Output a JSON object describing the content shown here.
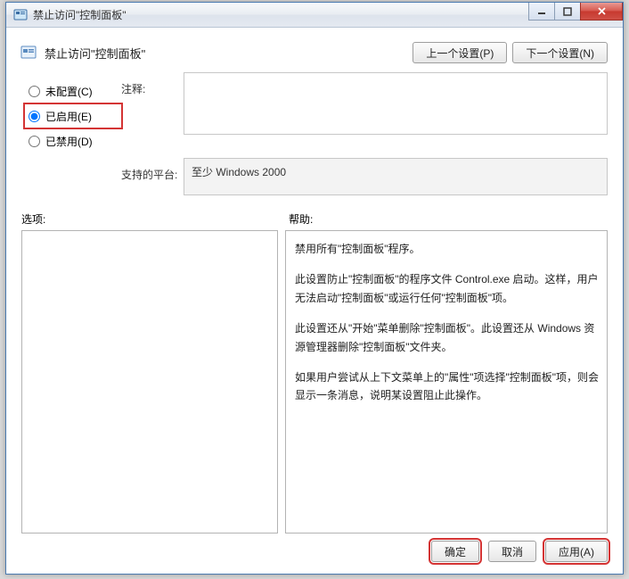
{
  "window": {
    "title": "禁止访问\"控制面板\""
  },
  "header": {
    "title": "禁止访问\"控制面板\"",
    "prev_button": "上一个设置(P)",
    "next_button": "下一个设置(N)"
  },
  "radios": {
    "not_configured": "未配置(C)",
    "enabled": "已启用(E)",
    "disabled": "已禁用(D)"
  },
  "labels": {
    "comment": "注释:",
    "supported_on": "支持的平台:",
    "options": "选项:",
    "help": "帮助:"
  },
  "supported_on": "至少 Windows 2000",
  "help_text": {
    "p1": "禁用所有\"控制面板\"程序。",
    "p2": "此设置防止\"控制面板\"的程序文件 Control.exe 启动。这样，用户无法启动\"控制面板\"或运行任何\"控制面板\"项。",
    "p3": "此设置还从\"开始\"菜单删除\"控制面板\"。此设置还从 Windows 资源管理器删除\"控制面板\"文件夹。",
    "p4": "如果用户尝试从上下文菜单上的\"属性\"项选择\"控制面板\"项，则会显示一条消息，说明某设置阻止此操作。"
  },
  "footer": {
    "ok": "确定",
    "cancel": "取消",
    "apply": "应用(A)"
  }
}
